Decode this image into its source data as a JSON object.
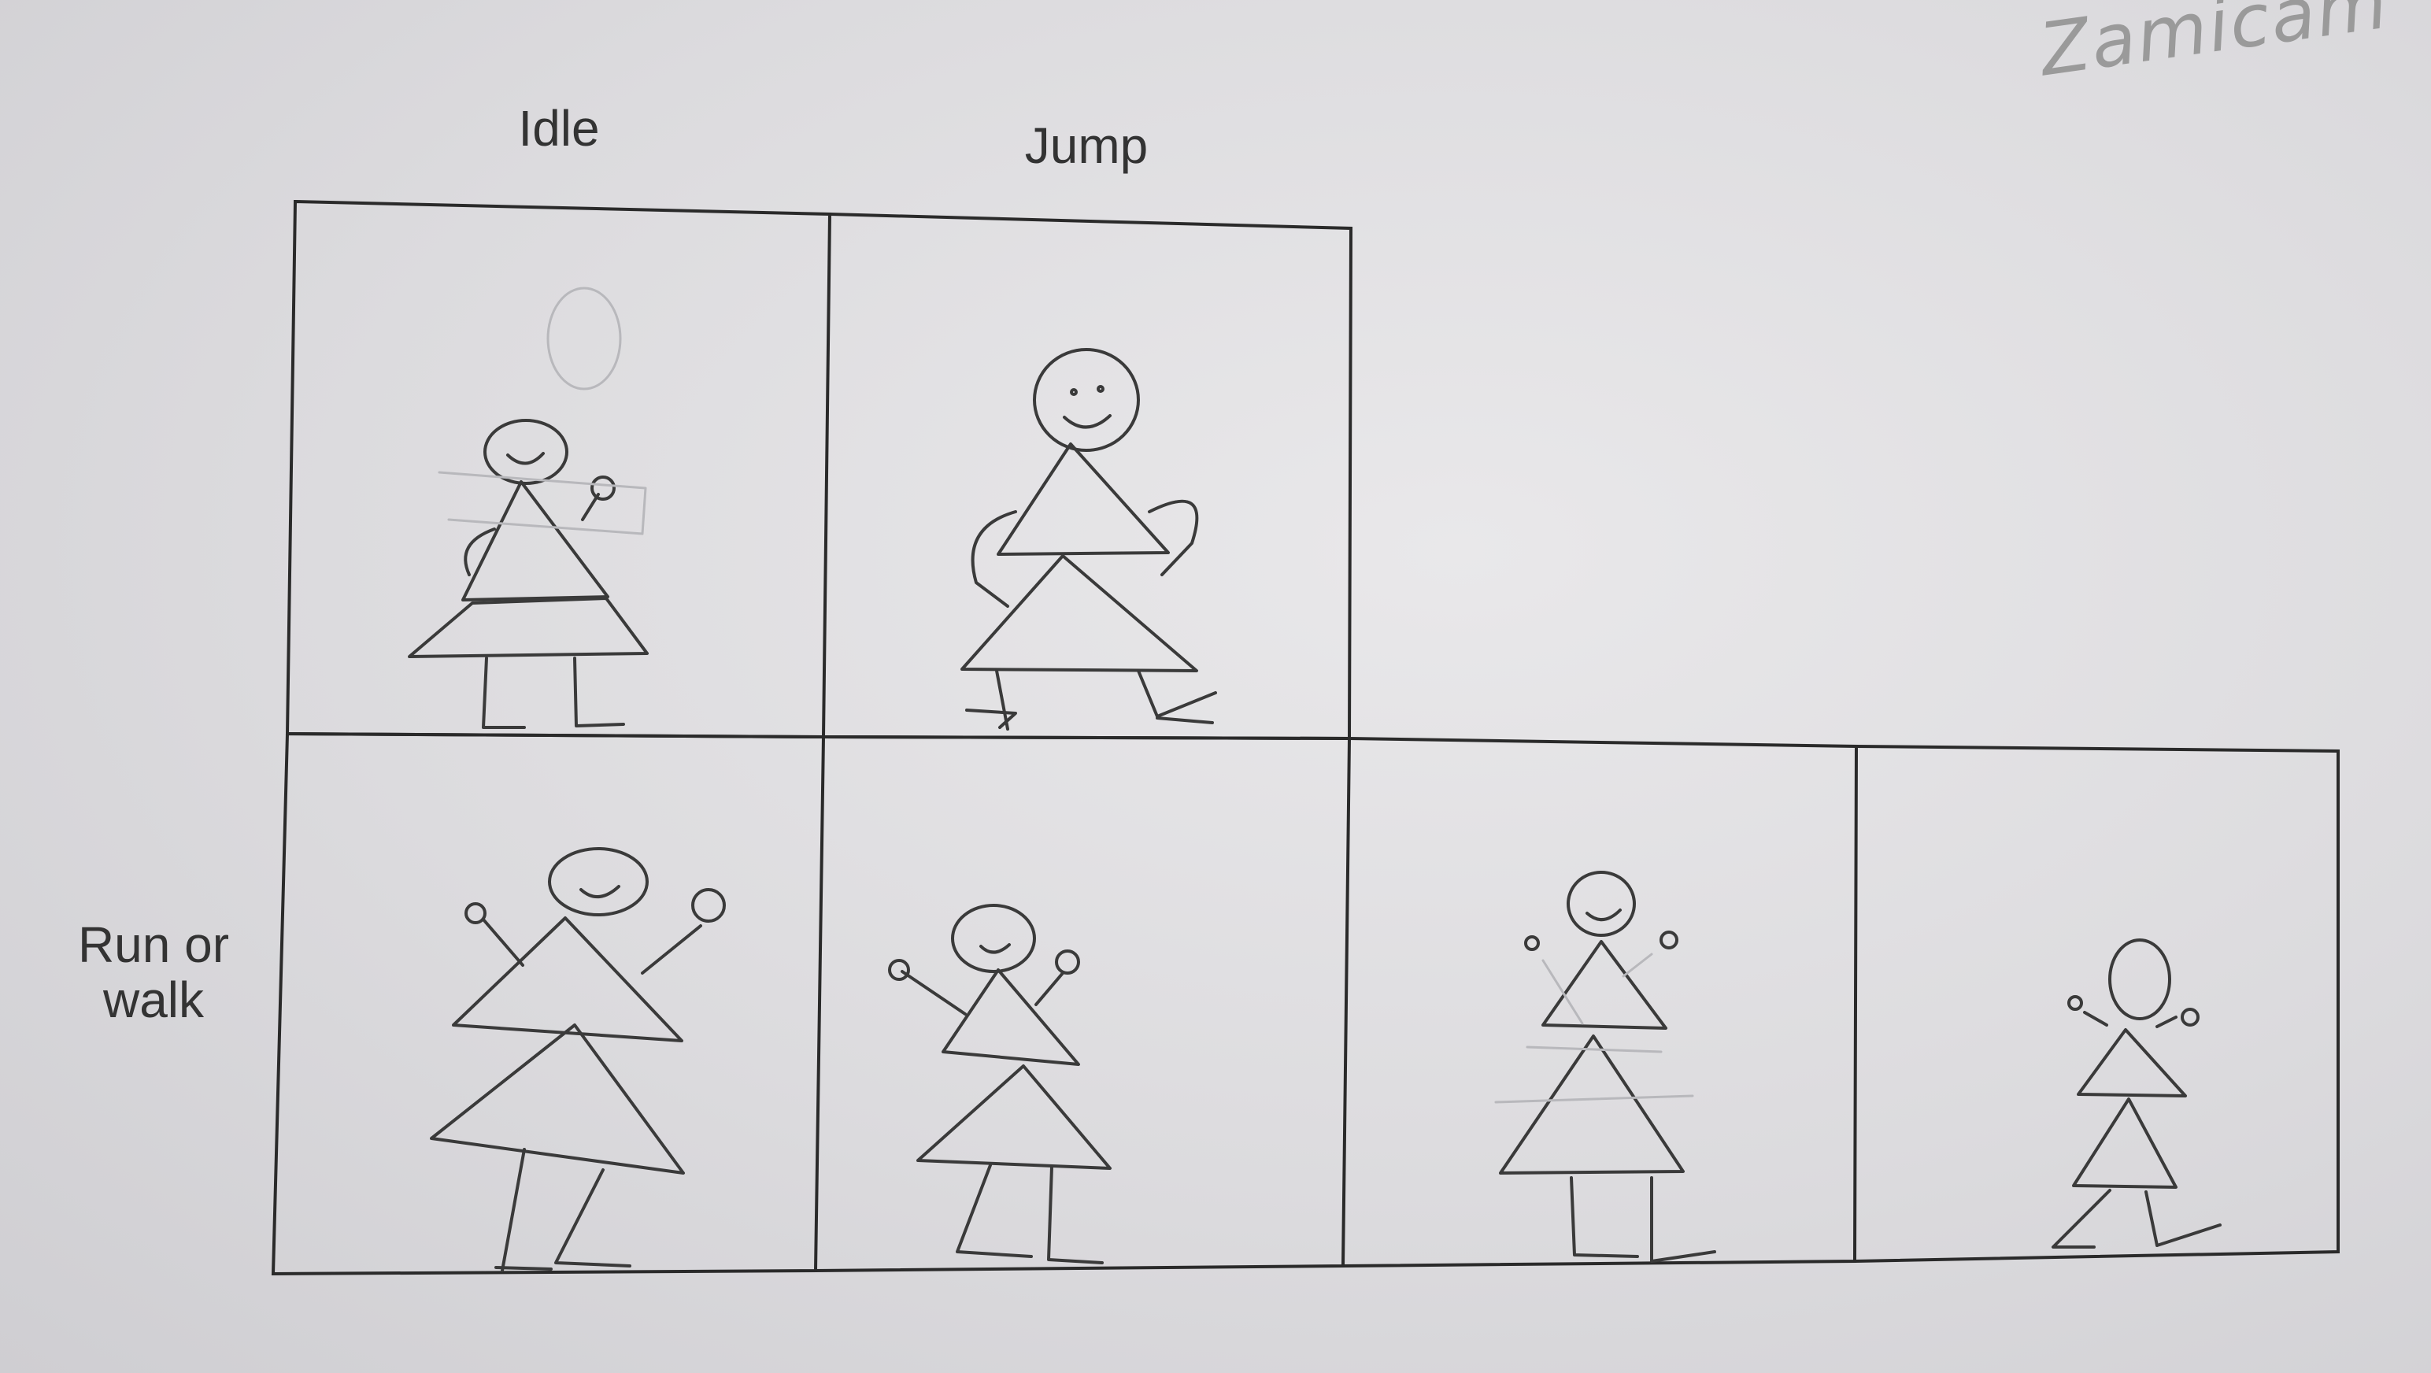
{
  "sheet": {
    "colors": {
      "paper": "#dddce0",
      "ink": "#2a2a2a",
      "pencil": "#3a3a3a",
      "faint": "#b8b8bc"
    },
    "column_labels": [
      "Idle",
      "Jump"
    ],
    "row_label": "Run or\nwalk",
    "signature": "Zamicam"
  },
  "panels": [
    {
      "id": "idle-frame",
      "row": "top",
      "column": "Idle",
      "content": "stick-figure-idle"
    },
    {
      "id": "jump-frame",
      "row": "top",
      "column": "Jump",
      "content": "stick-figure-jump"
    },
    {
      "id": "run-frame-1",
      "row": "bottom",
      "column": "Run or walk",
      "content": "stick-figure-run"
    },
    {
      "id": "run-frame-2",
      "row": "bottom",
      "column": "Run or walk",
      "content": "stick-figure-run"
    },
    {
      "id": "run-frame-3",
      "row": "bottom",
      "column": "Run or walk",
      "content": "stick-figure-run"
    },
    {
      "id": "run-frame-4",
      "row": "bottom",
      "column": "Run or walk",
      "content": "stick-figure-run"
    }
  ]
}
